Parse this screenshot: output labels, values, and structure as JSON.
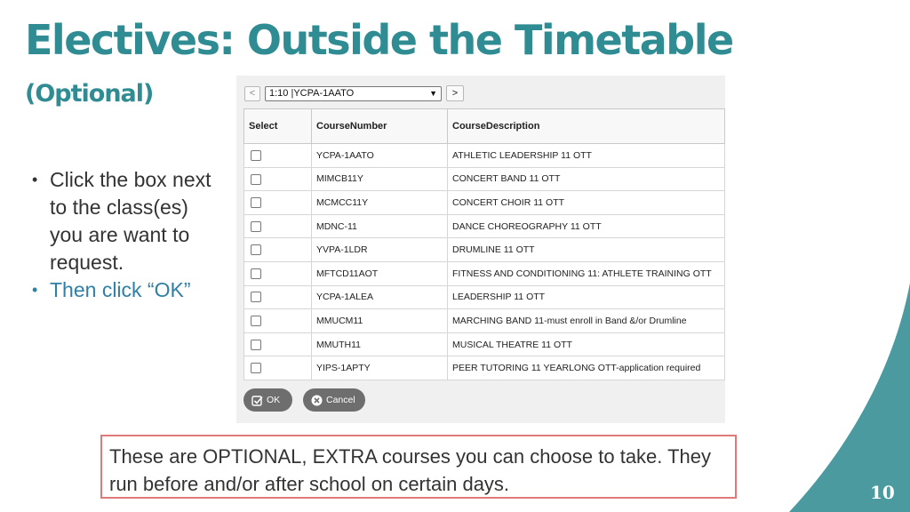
{
  "slide": {
    "title": "Electives: Outside the Timetable",
    "subtitle": "(Optional)",
    "bullets": [
      "Click the box next to the class(es) you are want to request.",
      "Then click “OK”"
    ],
    "note": "These are OPTIONAL, EXTRA courses you can choose to take. They run before and/or after school on certain days.",
    "page_number": "10",
    "accent_color": "#2f8c93",
    "curve_color": "#4a9aa0"
  },
  "nav": {
    "prev_label": "<",
    "next_label": ">",
    "selected": "1:10 |YCPA-1AATO"
  },
  "table": {
    "headers": [
      "Select",
      "CourseNumber",
      "CourseDescription"
    ],
    "rows": [
      {
        "number": "YCPA-1AATO",
        "description": "ATHLETIC LEADERSHIP 11 OTT"
      },
      {
        "number": "MIMCB11Y",
        "description": "CONCERT BAND 11 OTT"
      },
      {
        "number": "MCMCC11Y",
        "description": "CONCERT CHOIR 11 OTT"
      },
      {
        "number": "MDNC-11",
        "description": "DANCE CHOREOGRAPHY 11 OTT"
      },
      {
        "number": "YVPA-1LDR",
        "description": "DRUMLINE 11 OTT"
      },
      {
        "number": "MFTCD11AOT",
        "description": "FITNESS AND CONDITIONING 11: ATHLETE TRAINING OTT"
      },
      {
        "number": "YCPA-1ALEA",
        "description": "LEADERSHIP 11 OTT"
      },
      {
        "number": "MMUCM11",
        "description": "MARCHING BAND 11-must enroll in Band &/or Drumline"
      },
      {
        "number": "MMUTH11",
        "description": "MUSICAL THEATRE 11 OTT"
      },
      {
        "number": "YIPS-1APTY",
        "description": "PEER TUTORING 11 YEARLONG OTT-application required"
      }
    ]
  },
  "buttons": {
    "ok_label": "OK",
    "cancel_label": "Cancel"
  }
}
